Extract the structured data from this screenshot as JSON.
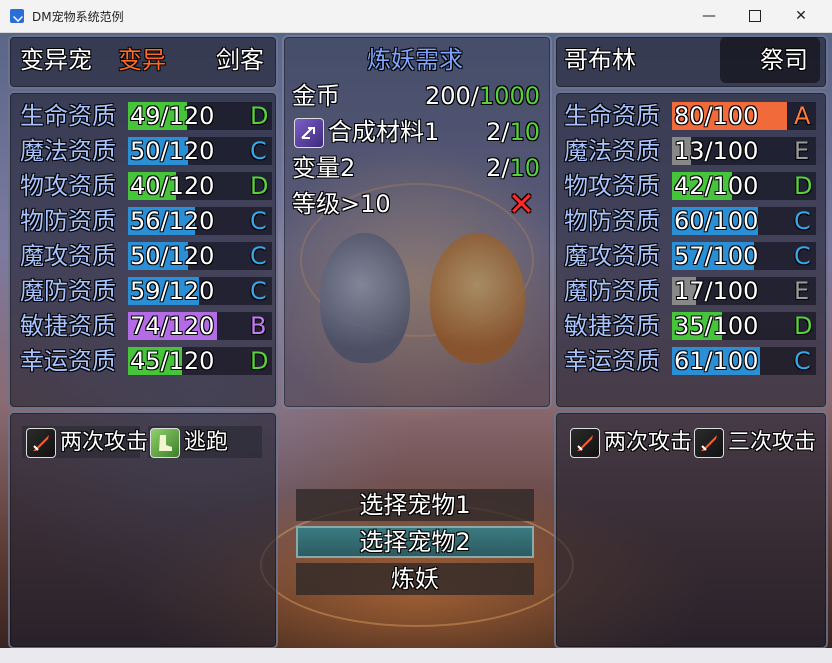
{
  "window": {
    "title": "DM宠物系统范例",
    "min_glyph": "—",
    "close_glyph": "✕"
  },
  "left": {
    "name": "变异宠",
    "tag": "变异",
    "tag_color": "#ff6a2a",
    "class": "剑客",
    "stats": [
      {
        "label": "生命资质",
        "value": "49/120",
        "fill": 0.408,
        "color": "#46c43a",
        "grade": "D",
        "grade_color": "#58d13f"
      },
      {
        "label": "魔法资质",
        "value": "50/120",
        "fill": 0.417,
        "color": "#2b8fd6",
        "grade": "C",
        "grade_color": "#3aa6e6"
      },
      {
        "label": "物攻资质",
        "value": "40/120",
        "fill": 0.333,
        "color": "#46c43a",
        "grade": "D",
        "grade_color": "#58d13f"
      },
      {
        "label": "物防资质",
        "value": "56/120",
        "fill": 0.467,
        "color": "#2b8fd6",
        "grade": "C",
        "grade_color": "#3aa6e6"
      },
      {
        "label": "魔攻资质",
        "value": "50/120",
        "fill": 0.417,
        "color": "#2b8fd6",
        "grade": "C",
        "grade_color": "#3aa6e6"
      },
      {
        "label": "魔防资质",
        "value": "59/120",
        "fill": 0.492,
        "color": "#2b8fd6",
        "grade": "C",
        "grade_color": "#3aa6e6"
      },
      {
        "label": "敏捷资质",
        "value": "74/120",
        "fill": 0.617,
        "color": "#b36be6",
        "grade": "B",
        "grade_color": "#c27bf0"
      },
      {
        "label": "幸运资质",
        "value": "45/120",
        "fill": 0.375,
        "color": "#46c43a",
        "grade": "D",
        "grade_color": "#58d13f"
      }
    ],
    "skills": [
      {
        "label": "两次攻击",
        "icon": "sword-icon"
      },
      {
        "label": "逃跑",
        "icon": "boot-icon"
      }
    ]
  },
  "center": {
    "title": "炼妖需求",
    "requirements": [
      {
        "label": "金币",
        "have": "200",
        "need": "1000"
      },
      {
        "label": "合成材料1",
        "have": "2",
        "need": "10",
        "icon": "material-icon"
      },
      {
        "label": "变量2",
        "have": "2",
        "need": "10"
      },
      {
        "label": "等级>10",
        "status": "✕"
      }
    ],
    "menu": [
      "选择宠物1",
      "选择宠物2",
      "炼妖"
    ],
    "selected_index": 1
  },
  "right": {
    "name": "哥布林",
    "class": "祭司",
    "stats": [
      {
        "label": "生命资质",
        "value": "80/100",
        "fill": 0.8,
        "color": "#f06a3a",
        "grade": "A",
        "grade_color": "#ff7a3a"
      },
      {
        "label": "魔法资质",
        "value": "13/100",
        "fill": 0.13,
        "color": "#888888",
        "grade": "E",
        "grade_color": "#9a9a9a"
      },
      {
        "label": "物攻资质",
        "value": "42/100",
        "fill": 0.42,
        "color": "#46c43a",
        "grade": "D",
        "grade_color": "#58d13f"
      },
      {
        "label": "物防资质",
        "value": "60/100",
        "fill": 0.6,
        "color": "#2b8fd6",
        "grade": "C",
        "grade_color": "#3aa6e6"
      },
      {
        "label": "魔攻资质",
        "value": "57/100",
        "fill": 0.57,
        "color": "#2b8fd6",
        "grade": "C",
        "grade_color": "#3aa6e6"
      },
      {
        "label": "魔防资质",
        "value": "17/100",
        "fill": 0.17,
        "color": "#888888",
        "grade": "E",
        "grade_color": "#9a9a9a"
      },
      {
        "label": "敏捷资质",
        "value": "35/100",
        "fill": 0.35,
        "color": "#46c43a",
        "grade": "D",
        "grade_color": "#58d13f"
      },
      {
        "label": "幸运资质",
        "value": "61/100",
        "fill": 0.61,
        "color": "#2b8fd6",
        "grade": "C",
        "grade_color": "#3aa6e6"
      }
    ],
    "skills": [
      {
        "label": "两次攻击",
        "icon": "sword-icon"
      },
      {
        "label": "三次攻击",
        "icon": "sword-icon"
      }
    ]
  },
  "colors": {
    "label": "#a8c4ff",
    "need": "#58d13f",
    "title": "#7ea6ff",
    "fail": "#ff2a2a"
  }
}
